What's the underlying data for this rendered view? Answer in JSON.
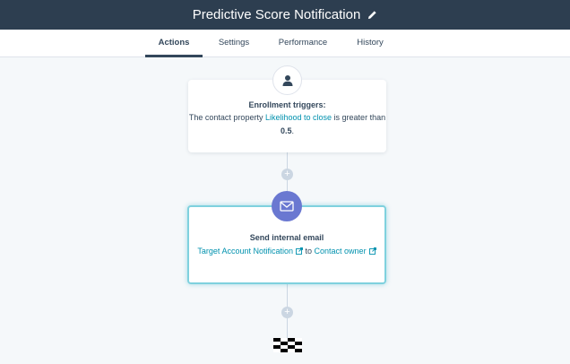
{
  "header": {
    "title": "Predictive Score Notification",
    "edit_icon": "pencil-icon"
  },
  "tabs": [
    {
      "label": "Actions",
      "active": true
    },
    {
      "label": "Settings",
      "active": false
    },
    {
      "label": "Performance",
      "active": false
    },
    {
      "label": "History",
      "active": false
    }
  ],
  "trigger": {
    "icon": "contact-icon",
    "heading": "Enrollment triggers:",
    "text_before": "The contact property",
    "property_link": "Likelihood to close",
    "text_middle": "is greater than",
    "value": "0.5",
    "text_end": "."
  },
  "action": {
    "icon": "envelope-icon",
    "heading": "Send internal email",
    "email_link": "Target Account Notification",
    "connector": "to",
    "recipient_link": "Contact owner"
  },
  "add_step_symbol": "+",
  "colors": {
    "header_bg": "#2d3e50",
    "canvas_bg": "#f5f8fa",
    "link": "#0091ae",
    "email_badge": "#6a78d1",
    "selected_border": "#7fd1de"
  }
}
